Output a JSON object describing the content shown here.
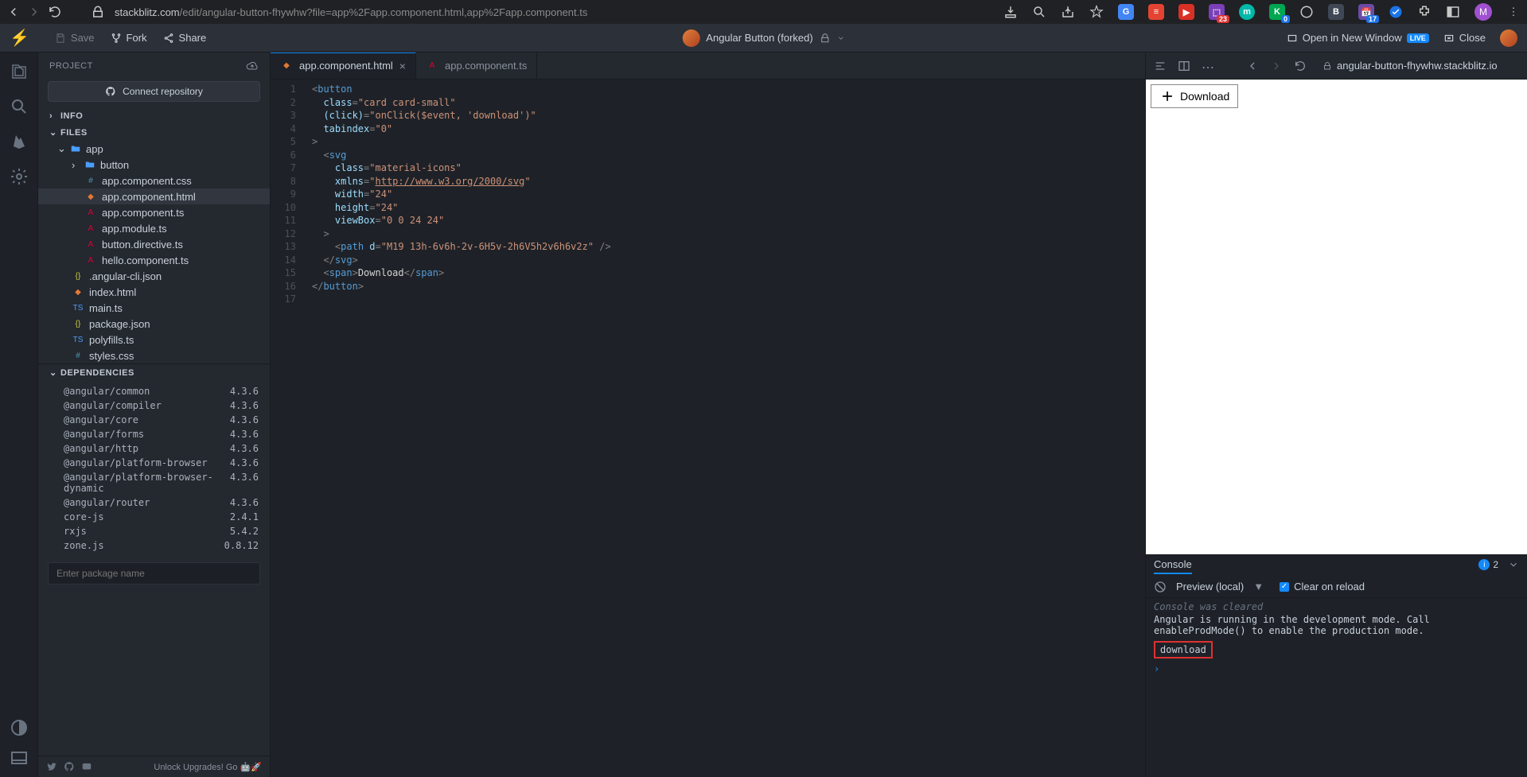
{
  "browser": {
    "url_host": "stackblitz.com",
    "url_path": "/edit/angular-button-fhywhw?file=app%2Fapp.component.html,app%2Fapp.component.ts",
    "extensions_badges": {
      "translate": "",
      "todoist": "",
      "store": "23",
      "m": "",
      "kx": "0",
      "b": "",
      "cal": "17"
    }
  },
  "app_bar": {
    "save": "Save",
    "fork": "Fork",
    "share": "Share",
    "title": "Angular Button (forked)",
    "open_new": "Open in New Window",
    "live": "LIVE",
    "close": "Close"
  },
  "sidebar": {
    "project": "PROJECT",
    "connect_repo": "Connect repository",
    "info": "INFO",
    "files": "FILES",
    "tree": {
      "app": "app",
      "button": "button",
      "app_css": "app.component.css",
      "app_html": "app.component.html",
      "app_ts": "app.component.ts",
      "app_mod": "app.module.ts",
      "btn_dir": "button.directive.ts",
      "hello": "hello.component.ts",
      "ng_cli": ".angular-cli.json",
      "index": "index.html",
      "main": "main.ts",
      "pkg": "package.json",
      "poly": "polyfills.ts",
      "styles": "styles.css"
    },
    "deps_hdr": "DEPENDENCIES",
    "deps": [
      {
        "n": "@angular/common",
        "v": "4.3.6"
      },
      {
        "n": "@angular/compiler",
        "v": "4.3.6"
      },
      {
        "n": "@angular/core",
        "v": "4.3.6"
      },
      {
        "n": "@angular/forms",
        "v": "4.3.6"
      },
      {
        "n": "@angular/http",
        "v": "4.3.6"
      },
      {
        "n": "@angular/platform-browser",
        "v": "4.3.6"
      },
      {
        "n": "@angular/platform-browser-dynamic",
        "v": "4.3.6"
      },
      {
        "n": "@angular/router",
        "v": "4.3.6"
      },
      {
        "n": "core-js",
        "v": "2.4.1"
      },
      {
        "n": "rxjs",
        "v": "5.4.2"
      },
      {
        "n": "zone.js",
        "v": "0.8.12"
      }
    ],
    "pkg_placeholder": "Enter package name",
    "upgrade": "Unlock Upgrades! Go"
  },
  "tabs": {
    "active": "app.component.html",
    "second": "app.component.ts"
  },
  "code_lines": 17,
  "preview": {
    "url": "angular-button-fhywhw.stackblitz.io",
    "download_btn": "Download"
  },
  "console": {
    "title": "Console",
    "count": "2",
    "preview_local": "Preview (local)",
    "clear_reload": "Clear on reload",
    "cleared": "Console was cleared",
    "info_msg": "Angular is running in the development mode. Call enableProdMode() to enable the production mode.",
    "download_log": "download"
  }
}
